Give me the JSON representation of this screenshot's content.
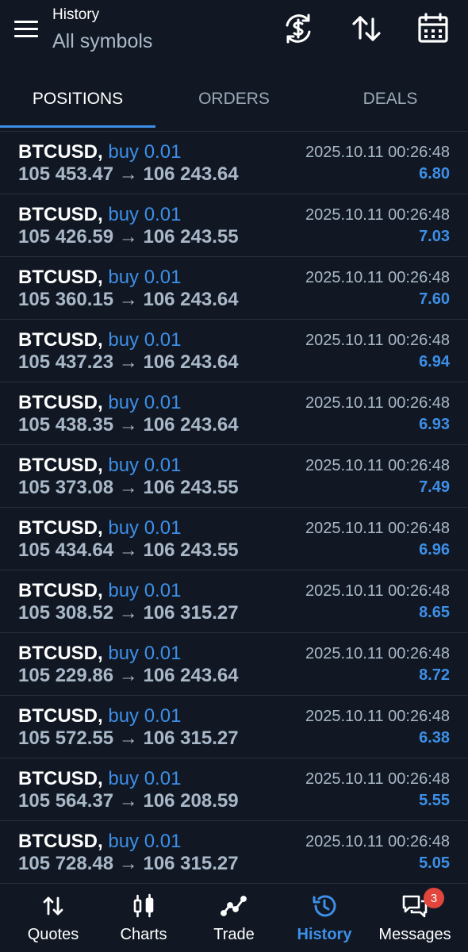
{
  "header": {
    "title": "History",
    "subtitle": "All symbols"
  },
  "icons": {
    "menu": "hamburger-menu-icon",
    "convert": "currency-exchange-icon",
    "sort": "sort-arrows-icon",
    "calendar": "calendar-icon"
  },
  "tabs": [
    {
      "label": "POSITIONS",
      "active": true
    },
    {
      "label": "ORDERS",
      "active": false
    },
    {
      "label": "DEALS",
      "active": false
    }
  ],
  "arrow": "→",
  "positions": [
    {
      "symbol": "BTCUSD,",
      "side": "buy 0.01",
      "open": "105 453.47",
      "close": "106 243.64",
      "time": "2025.10.11 00:26:48",
      "profit": "6.80"
    },
    {
      "symbol": "BTCUSD,",
      "side": "buy 0.01",
      "open": "105 426.59",
      "close": "106 243.55",
      "time": "2025.10.11 00:26:48",
      "profit": "7.03"
    },
    {
      "symbol": "BTCUSD,",
      "side": "buy 0.01",
      "open": "105 360.15",
      "close": "106 243.64",
      "time": "2025.10.11 00:26:48",
      "profit": "7.60"
    },
    {
      "symbol": "BTCUSD,",
      "side": "buy 0.01",
      "open": "105 437.23",
      "close": "106 243.64",
      "time": "2025.10.11 00:26:48",
      "profit": "6.94"
    },
    {
      "symbol": "BTCUSD,",
      "side": "buy 0.01",
      "open": "105 438.35",
      "close": "106 243.64",
      "time": "2025.10.11 00:26:48",
      "profit": "6.93"
    },
    {
      "symbol": "BTCUSD,",
      "side": "buy 0.01",
      "open": "105 373.08",
      "close": "106 243.55",
      "time": "2025.10.11 00:26:48",
      "profit": "7.49"
    },
    {
      "symbol": "BTCUSD,",
      "side": "buy 0.01",
      "open": "105 434.64",
      "close": "106 243.55",
      "time": "2025.10.11 00:26:48",
      "profit": "6.96"
    },
    {
      "symbol": "BTCUSD,",
      "side": "buy 0.01",
      "open": "105 308.52",
      "close": "106 315.27",
      "time": "2025.10.11 00:26:48",
      "profit": "8.65"
    },
    {
      "symbol": "BTCUSD,",
      "side": "buy 0.01",
      "open": "105 229.86",
      "close": "106 243.64",
      "time": "2025.10.11 00:26:48",
      "profit": "8.72"
    },
    {
      "symbol": "BTCUSD,",
      "side": "buy 0.01",
      "open": "105 572.55",
      "close": "106 315.27",
      "time": "2025.10.11 00:26:48",
      "profit": "6.38"
    },
    {
      "symbol": "BTCUSD,",
      "side": "buy 0.01",
      "open": "105 564.37",
      "close": "106 208.59",
      "time": "2025.10.11 00:26:48",
      "profit": "5.55"
    },
    {
      "symbol": "BTCUSD,",
      "side": "buy 0.01",
      "open": "105 728.48",
      "close": "106 315.27",
      "time": "2025.10.11 00:26:48",
      "profit": "5.05"
    }
  ],
  "nav": {
    "quotes": "Quotes",
    "charts": "Charts",
    "trade": "Trade",
    "history": "History",
    "messages": "Messages",
    "messages_badge": "3",
    "active": "history"
  },
  "colors": {
    "background": "#111823",
    "accent": "#3d8fe8",
    "muted_text": "#a9b8c8",
    "divider": "#263040",
    "badge": "#e2453c"
  }
}
